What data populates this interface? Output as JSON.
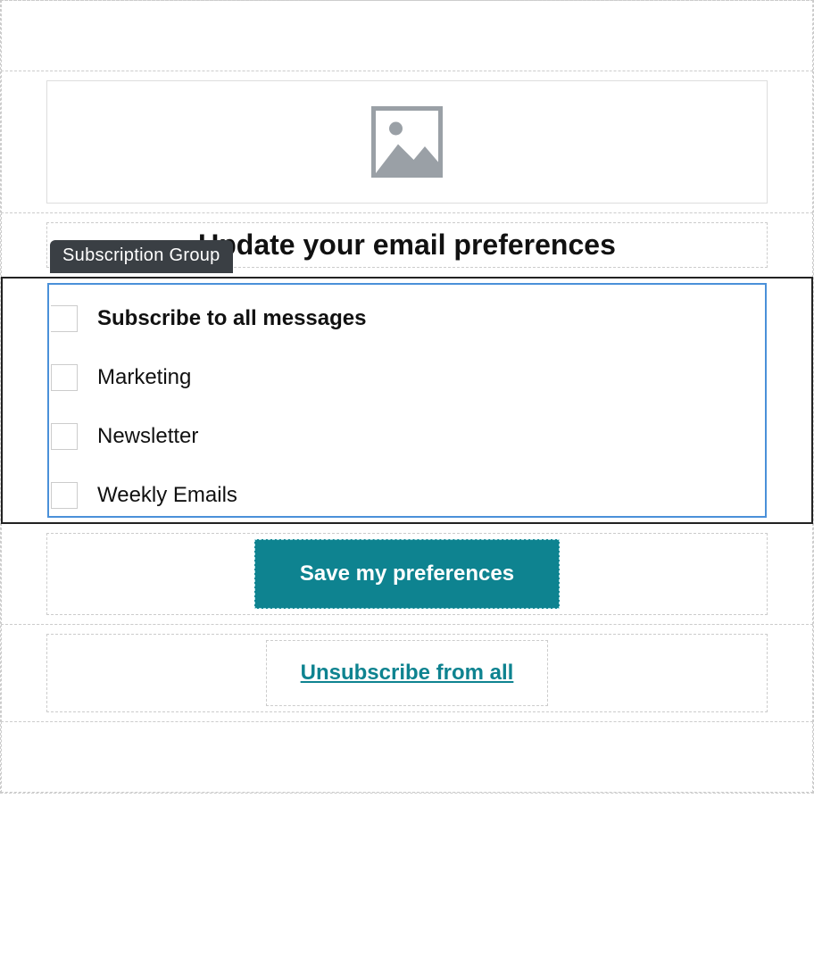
{
  "heading": "Update your email preferences",
  "subscription_group": {
    "block_label": "Subscription Group",
    "items": [
      {
        "label": "Subscribe to all messages",
        "checked": false,
        "bold": true
      },
      {
        "label": "Marketing",
        "checked": false,
        "bold": false
      },
      {
        "label": "Newsletter",
        "checked": false,
        "bold": false
      },
      {
        "label": "Weekly Emails",
        "checked": false,
        "bold": false
      }
    ]
  },
  "save_button_label": "Save my preferences",
  "unsubscribe_link_label": "Unsubscribe from all",
  "colors": {
    "accent": "#0e8390",
    "selection_border": "#4a90d9",
    "label_bg": "#3a3f44"
  }
}
